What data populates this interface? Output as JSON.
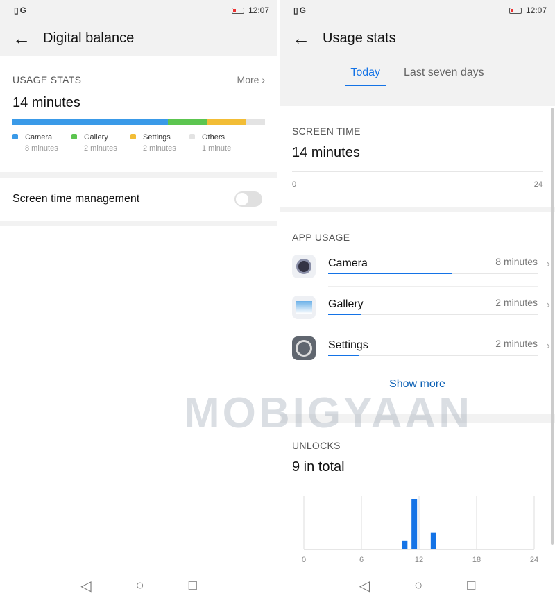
{
  "left": {
    "status": {
      "icons": "▯G",
      "time": "12:07"
    },
    "title": "Digital balance",
    "usage": {
      "section": "USAGE STATS",
      "more": "More",
      "total": "14 minutes",
      "items": [
        {
          "name": "Camera",
          "value": "8 minutes",
          "minutes": 8,
          "color": "#3a9ae8"
        },
        {
          "name": "Gallery",
          "value": "2 minutes",
          "minutes": 2,
          "color": "#5cc550"
        },
        {
          "name": "Settings",
          "value": "2 minutes",
          "minutes": 2,
          "color": "#f2bd36"
        },
        {
          "name": "Others",
          "value": "1 minute",
          "minutes": 1,
          "color": "#e3e3e3"
        }
      ]
    },
    "management": {
      "label": "Screen time management",
      "enabled": false
    }
  },
  "right": {
    "status": {
      "icons": "▯G",
      "time": "12:07"
    },
    "title": "Usage stats",
    "tabs": [
      {
        "label": "Today",
        "active": true
      },
      {
        "label": "Last seven days",
        "active": false
      }
    ],
    "screen_time": {
      "section": "SCREEN TIME",
      "total": "14 minutes",
      "axis_start": "0",
      "axis_end": "24"
    },
    "app_usage": {
      "section": "APP USAGE",
      "apps": [
        {
          "name": "Camera",
          "value": "8 minutes",
          "fraction": 0.59,
          "icon": "camera-icon"
        },
        {
          "name": "Gallery",
          "value": "2 minutes",
          "fraction": 0.16,
          "icon": "gallery-icon"
        },
        {
          "name": "Settings",
          "value": "2 minutes",
          "fraction": 0.15,
          "icon": "settings-icon"
        }
      ],
      "show_more": "Show more"
    },
    "unlocks": {
      "section": "UNLOCKS",
      "total": "9 in total"
    }
  },
  "chart_data": {
    "type": "bar",
    "x_ticks": [
      "0",
      "6",
      "12",
      "18",
      "24"
    ],
    "xlim": [
      0,
      24
    ],
    "hours": [
      10,
      11,
      13
    ],
    "values": [
      1,
      6,
      2
    ],
    "grid": true,
    "color": "#1473e6"
  },
  "watermark": "MOBIGYAAN"
}
